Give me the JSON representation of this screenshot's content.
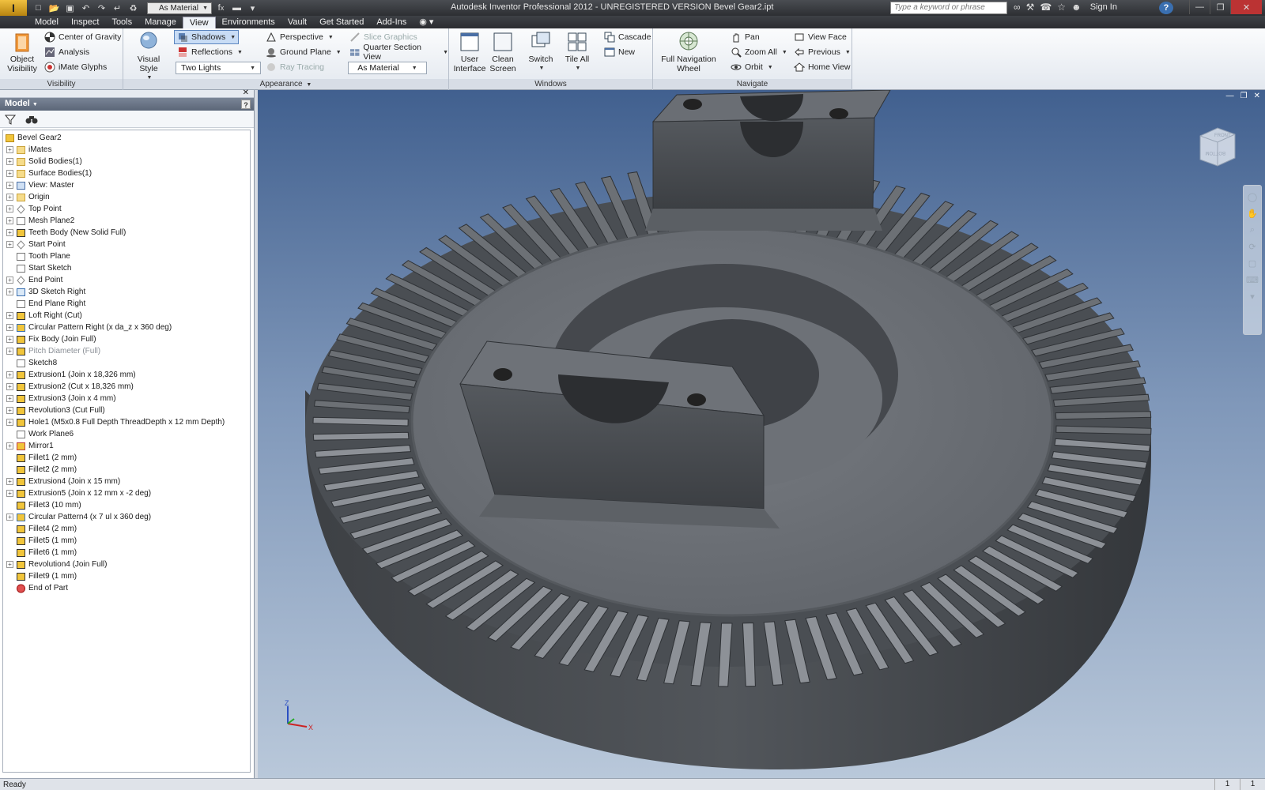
{
  "titlebar": {
    "logo_text": "I",
    "logo_sub": "PRO",
    "material_select": "As Material",
    "title": "Autodesk Inventor Professional 2012 - UNREGISTERED VERSION    Bevel Gear2.ipt",
    "search_placeholder": "Type a keyword or phrase",
    "signin": "Sign In",
    "help": "?"
  },
  "tabs": [
    "Model",
    "Inspect",
    "Tools",
    "Manage",
    "View",
    "Environments",
    "Vault",
    "Get Started",
    "Add-Ins"
  ],
  "active_tab": "View",
  "ribbon": {
    "visibility": {
      "title": "Visibility",
      "object_visibility": "Object Visibility",
      "center_of_gravity": "Center of Gravity",
      "analysis": "Analysis",
      "imate_glyphs": "iMate Glyphs"
    },
    "appearance": {
      "title": "Appearance",
      "visual_style": "Visual Style",
      "shadows": "Shadows",
      "reflections": "Reflections",
      "lighting_select": "Two Lights",
      "perspective": "Perspective",
      "ground_plane": "Ground Plane",
      "ray_tracing": "Ray Tracing",
      "slice_graphics": "Slice Graphics",
      "quarter_section_view": "Quarter Section View",
      "material_select": "As Material"
    },
    "windows": {
      "title": "Windows",
      "user_interface": "User Interface",
      "clean_screen": "Clean Screen",
      "switch": "Switch",
      "tile_all": "Tile All",
      "cascade": "Cascade",
      "new": "New"
    },
    "navigate": {
      "title": "Navigate",
      "full_navigation_wheel": "Full Navigation Wheel",
      "pan": "Pan",
      "zoom_all": "Zoom All",
      "orbit": "Orbit",
      "view_face": "View Face",
      "previous": "Previous",
      "home_view": "Home View"
    }
  },
  "browser": {
    "header": "Model",
    "help": "?",
    "items": [
      {
        "label": "Bevel Gear2",
        "icon": "part-icon",
        "root": true
      },
      {
        "label": "iMates",
        "icon": "folder-icon",
        "exp": true
      },
      {
        "label": "Solid Bodies(1)",
        "icon": "folder-icon",
        "exp": true
      },
      {
        "label": "Surface Bodies(1)",
        "icon": "folder-icon",
        "exp": true
      },
      {
        "label": "View: Master",
        "icon": "view-icon",
        "exp": true
      },
      {
        "label": "Origin",
        "icon": "folder-icon",
        "exp": true
      },
      {
        "label": "Top Point",
        "icon": "point-icon",
        "exp": true
      },
      {
        "label": "Mesh Plane2",
        "icon": "plane-icon",
        "exp": true
      },
      {
        "label": "Teeth Body (New Solid Full)",
        "icon": "feature-icon",
        "exp": true
      },
      {
        "label": "Start Point",
        "icon": "point-icon",
        "exp": true
      },
      {
        "label": "Tooth Plane",
        "icon": "plane-icon",
        "exp": false
      },
      {
        "label": "Start Sketch",
        "icon": "sketch-icon",
        "exp": false
      },
      {
        "label": "End Point",
        "icon": "point-icon",
        "exp": true
      },
      {
        "label": "3D Sketch Right",
        "icon": "sketch3d-icon",
        "exp": true
      },
      {
        "label": "End Plane Right",
        "icon": "plane-icon",
        "exp": false
      },
      {
        "label": "Loft Right (Cut)",
        "icon": "feature-icon",
        "exp": true
      },
      {
        "label": "Circular Pattern Right (x da_z x 360 deg)",
        "icon": "pattern-icon",
        "exp": true
      },
      {
        "label": "Fix Body (Join Full)",
        "icon": "feature-icon",
        "exp": true
      },
      {
        "label": "Pitch Diameter (Full)",
        "icon": "feature-icon",
        "exp": true,
        "dim": true
      },
      {
        "label": "Sketch8",
        "icon": "sketch-icon",
        "exp": false
      },
      {
        "label": "Extrusion1 (Join x 18,326 mm)",
        "icon": "feature-icon",
        "exp": true
      },
      {
        "label": "Extrusion2 (Cut x 18,326 mm)",
        "icon": "feature-icon",
        "exp": true
      },
      {
        "label": "Extrusion3 (Join x 4 mm)",
        "icon": "feature-icon",
        "exp": true
      },
      {
        "label": "Revolution3 (Cut Full)",
        "icon": "feature-icon",
        "exp": true
      },
      {
        "label": "Hole1 (M5x0.8 Full Depth ThreadDepth x 12 mm Depth)",
        "icon": "feature-icon",
        "exp": true
      },
      {
        "label": "Work Plane6",
        "icon": "plane-icon",
        "exp": false
      },
      {
        "label": "Mirror1",
        "icon": "mirror-icon",
        "exp": true
      },
      {
        "label": "Fillet1 (2 mm)",
        "icon": "fillet-icon",
        "exp": false
      },
      {
        "label": "Fillet2 (2 mm)",
        "icon": "fillet-icon",
        "exp": false
      },
      {
        "label": "Extrusion4 (Join x 15 mm)",
        "icon": "feature-icon",
        "exp": true
      },
      {
        "label": "Extrusion5 (Join x 12 mm x -2 deg)",
        "icon": "feature-icon",
        "exp": true
      },
      {
        "label": "Fillet3 (10 mm)",
        "icon": "fillet-icon",
        "exp": false
      },
      {
        "label": "Circular Pattern4 (x 7 ul x 360 deg)",
        "icon": "pattern-icon",
        "exp": true
      },
      {
        "label": "Fillet4 (2 mm)",
        "icon": "fillet-icon",
        "exp": false
      },
      {
        "label": "Fillet5 (1 mm)",
        "icon": "fillet-icon",
        "exp": false
      },
      {
        "label": "Fillet6 (1 mm)",
        "icon": "fillet-icon",
        "exp": false
      },
      {
        "label": "Revolution4 (Join Full)",
        "icon": "feature-icon",
        "exp": true
      },
      {
        "label": "Fillet9 (1 mm)",
        "icon": "fillet-icon",
        "exp": false
      },
      {
        "label": "End of Part",
        "icon": "end-of-part-icon",
        "exp": false
      }
    ]
  },
  "viewport": {
    "viewcube_top": "FRONT",
    "viewcube_side": "BOTTOM",
    "axis_x": "X",
    "axis_y": "Y",
    "axis_z": "Z"
  },
  "status": {
    "text": "Ready",
    "right_1": "1",
    "right_2": "1"
  },
  "colors": {
    "accent": "#3a6fb0",
    "gear": "#5d6166",
    "viewport_top": "#41608f",
    "viewport_bottom": "#b9c8da"
  }
}
